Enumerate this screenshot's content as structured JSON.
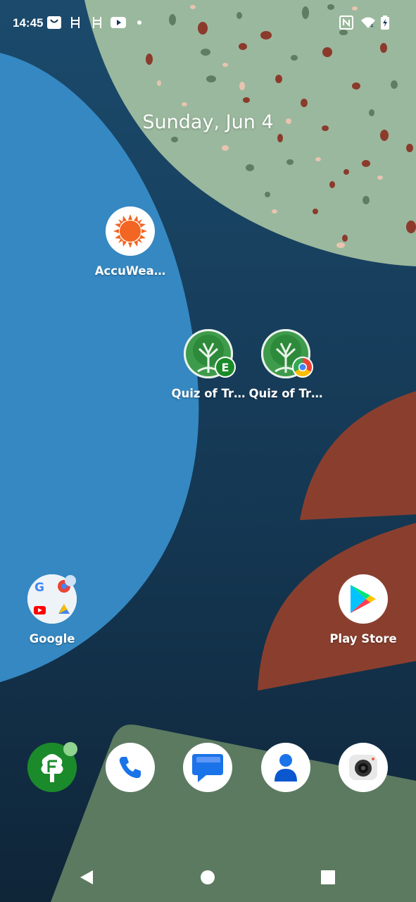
{
  "status_bar": {
    "time": "14:45",
    "left_icons": [
      "bag-icon",
      "ladder-icon",
      "ladder-icon",
      "youtube-icon",
      "dot-icon"
    ],
    "right_icons": [
      "nfc-icon",
      "wifi-icon",
      "battery-charging-icon"
    ]
  },
  "date": "Sunday, Jun 4",
  "apps": {
    "accuweather": {
      "label": "AccuWea…"
    },
    "quiz_1": {
      "label": "Quiz of Tr…",
      "badge": "evergreen-badge-icon"
    },
    "quiz_2": {
      "label": "Quiz of Tr…",
      "badge": "chrome-badge-icon"
    },
    "google_folder": {
      "label": "Google",
      "contents": [
        "google-icon",
        "chrome-icon",
        "youtube-icon",
        "drive-icon"
      ]
    },
    "play_store": {
      "label": "Play Store"
    }
  },
  "dock": [
    "evergreen-app-icon",
    "phone-icon",
    "messages-icon",
    "contacts-icon",
    "camera-icon"
  ],
  "nav": [
    "back-icon",
    "home-icon",
    "recents-icon"
  ],
  "colors": {
    "wallpaper_dark": "#143a57",
    "wallpaper_blue": "#3588c2",
    "wallpaper_green": "#9ab89d",
    "wallpaper_rust": "#8a3f2e",
    "wallpaper_sage": "#5c7a60",
    "accuweather_orange": "#f26522",
    "evergreen_green": "#1b8a2a"
  }
}
